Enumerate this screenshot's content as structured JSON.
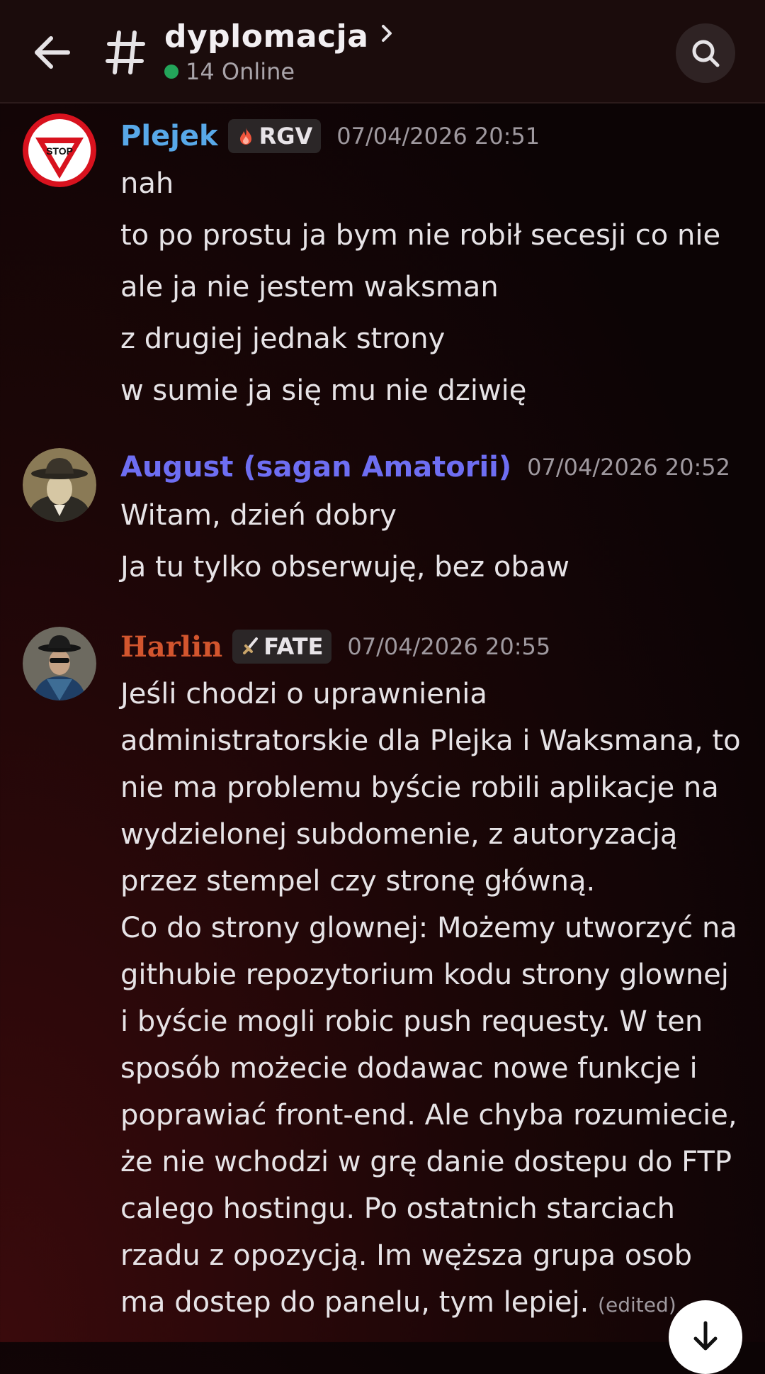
{
  "header": {
    "channel_title": "dyplomacja",
    "online_text": "14 Online"
  },
  "messages": [
    {
      "author": "Plejek",
      "author_color": "#58a8e8",
      "tag": "RGV",
      "timestamp": "07/04/2026 20:51",
      "lines": [
        "nah",
        "to po prostu ja bym nie robił secesji co nie",
        "ale ja nie jestem waksman",
        "z drugiej jednak strony",
        "w sumie ja się mu nie dziwię"
      ]
    },
    {
      "author": "August (sagan Amatorii)",
      "author_color": "#6e6ef2",
      "timestamp": "07/04/2026 20:52",
      "lines": [
        "Witam, dzień dobry",
        "Ja tu tylko obserwuję, bez obaw"
      ]
    },
    {
      "author": "Harlin",
      "author_color": "#d2552e",
      "tag": "FATE",
      "timestamp": "07/04/2026 20:55",
      "paragraph1": "Jeśli chodzi o uprawnienia administratorskie dla Plejka i Waksmana, to nie ma problemu byście robili aplikacje na wydzielonej subdomenie, z autoryzacją przez stempel czy stronę główną.",
      "paragraph2": "Co do strony glownej: Możemy utworzyć na githubie repozytorium kodu strony glownej i byście mogli robic push requesty. W ten sposób możecie dodawac nowe funkcje i poprawiać front-end. Ale chyba rozumiecie, że nie wchodzi w grę danie dostepu do FTP calego hostingu. Po ostatnich starciach rzadu z opozycją. Im węższa grupa osob ma dostep do panelu, tym lepiej.",
      "edited_label": "(edited)"
    }
  ],
  "avatars": {
    "plejek_sign_text": "STOP"
  },
  "icons": {
    "back": "arrow-left-icon",
    "channel": "hash-icon",
    "chevron": "chevron-right-icon",
    "search": "search-icon",
    "rgv_tag": "fire-icon",
    "fate_tag": "sword-icon",
    "scroll": "arrow-down-icon"
  },
  "colors": {
    "online_dot": "#23a55a",
    "header_bg": "#1b0c0c"
  }
}
